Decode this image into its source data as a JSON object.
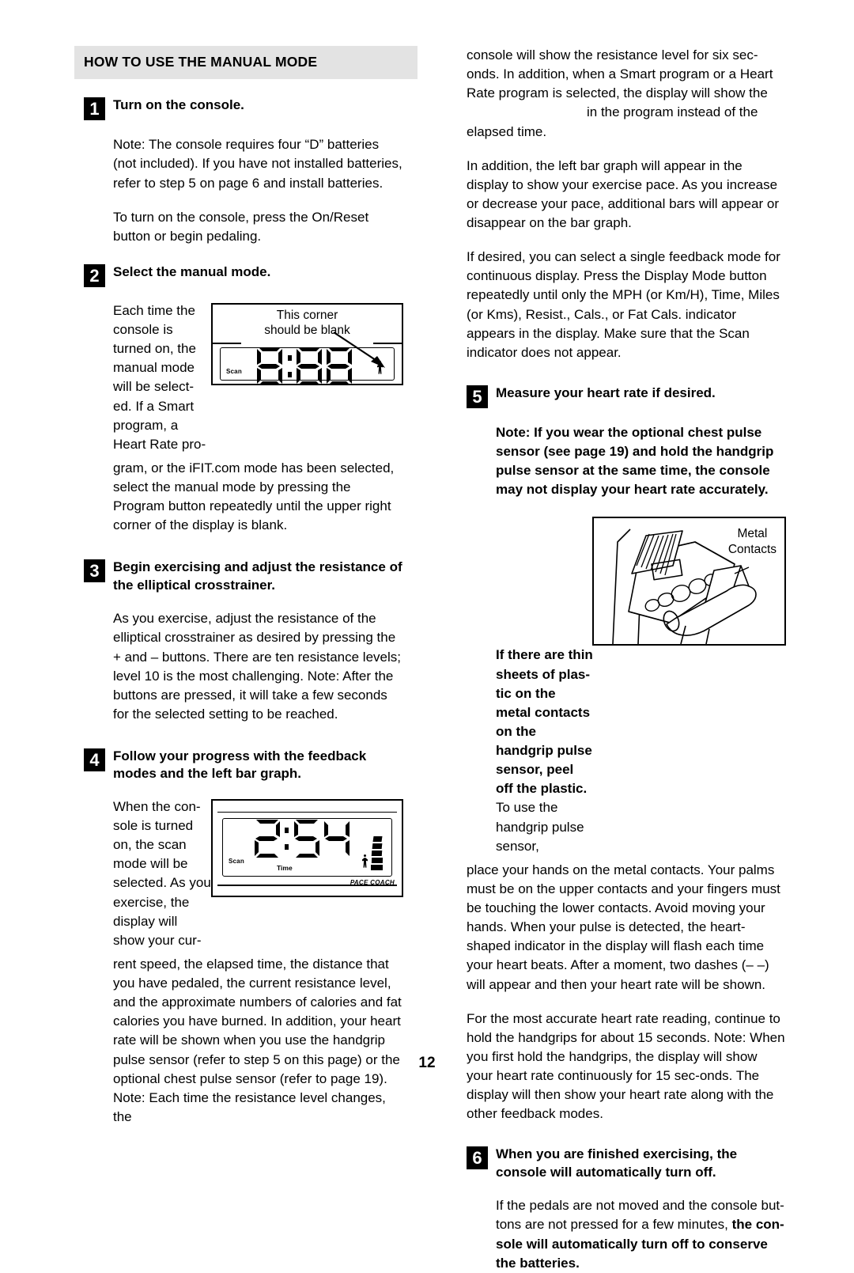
{
  "page": {
    "number": "12"
  },
  "section": {
    "heading": "HOW TO USE THE MANUAL MODE"
  },
  "left_column": {
    "step1": {
      "number": "1",
      "title": "Turn on the console.",
      "para1": "Note: The console requires four “D” batteries (not included). If you have not installed batteries, refer to step 5 on page 6 and install batteries.",
      "para2": "To turn on the console, press the On/Reset button or begin pedaling."
    },
    "step2": {
      "number": "2",
      "title": "Select the manual mode.",
      "side_text": "Each time the console is turned on, the manual mode will be select-ed. If a Smart program, a Heart Rate pro-",
      "flow_text": "gram, or the iFIT.com mode has been selected, select the manual mode by pressing the Program button repeatedly until the upper right corner of the display is blank.",
      "figure": {
        "caption_line1": "This corner",
        "caption_line2": "should be blank",
        "display_value": "0:00",
        "scan_label": "Scan"
      }
    },
    "step3": {
      "number": "3",
      "title": "Begin exercising and adjust the resistance of the elliptical crosstrainer.",
      "para1": "As you exercise, adjust the resistance of the elliptical crosstrainer as desired by pressing the + and – buttons. There are ten resistance levels; level 10 is the most challenging. Note: After the buttons are pressed, it will take a few seconds for the selected setting to be reached."
    },
    "step4": {
      "number": "4",
      "title": "Follow your progress with the feedback modes and the left bar graph.",
      "side_text": "When the con-sole is turned on, the scan mode will be selected. As you exercise, the display will show your cur-",
      "flow_text": "rent speed, the elapsed time, the distance that you have pedaled, the current resistance level, and the approximate numbers of calories and fat calories you have burned. In addition, your heart rate will be shown when you use the handgrip pulse sensor (refer to step 5 on this page) or the optional chest pulse sensor (refer to page 19). Note: Each time the resistance level changes, the",
      "figure": {
        "display_value": "2:54",
        "scan_label": "Scan",
        "time_label": "Time",
        "pace_label": "PACE COACH"
      }
    }
  },
  "right_column": {
    "para1_part1": "console will show the resistance level for six sec-onds. In addition, when a Smart program or a Heart Rate program is selected, the display will show the",
    "para1_part2": "in the program instead of the elapsed time.",
    "para2": "In addition, the left bar graph will appear in the display to show your exercise pace. As you increase or decrease your pace, additional bars will appear or disappear on the bar graph.",
    "para3": "If desired, you can select a single feedback mode for continuous display. Press the Display Mode button repeatedly until only the MPH (or Km/H), Time, Miles (or Kms), Resist., Cals., or Fat Cals. indicator appears in the display. Make sure that the Scan indicator does not appear.",
    "step5": {
      "number": "5",
      "title": "Measure your heart rate if desired.",
      "note": "Note: If you wear the optional chest pulse sensor (see page 19) and hold the handgrip pulse sensor at the same time, the console may not display your heart rate accurately.",
      "side_text_bold": "If there are thin sheets of plas-tic on the metal contacts on the handgrip pulse sensor, peel off the plastic.",
      "side_text_plain": " To use the handgrip pulse sensor,",
      "flow_text": "place your hands on the metal contacts. Your palms must be on the upper contacts and your fingers must be touching the lower contacts. Avoid moving your hands. When your pulse is detected, the heart-shaped indicator in the display will flash each time your heart beats. After a moment, two dashes (– –) will appear and then your heart rate will be shown.",
      "para_after": "For the most accurate heart rate reading, continue to hold the handgrips for about 15 seconds. Note: When you first hold the handgrips, the display will show your heart rate continuously for 15 sec-onds. The display will then show your heart rate along with the other feedback modes.",
      "figure": {
        "label_line1": "Metal",
        "label_line2": "Contacts"
      }
    },
    "step6": {
      "number": "6",
      "title": "When you are finished exercising, the console will automatically turn off.",
      "para_plain": "If the pedals are not moved and the console but-tons are not pressed for a few minutes, ",
      "para_bold": "the con-sole will automatically turn off to conserve the batteries."
    }
  }
}
